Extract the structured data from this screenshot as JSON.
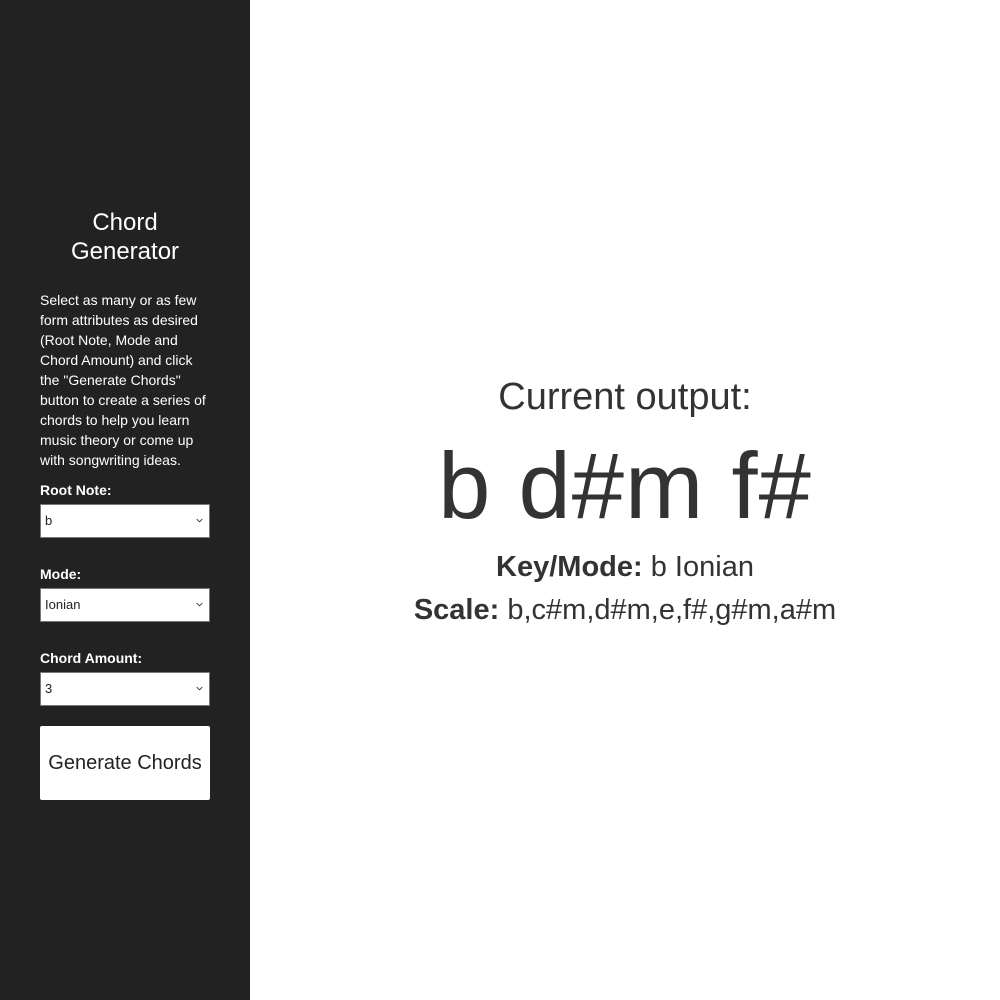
{
  "sidebar": {
    "title": "Chord\nGenerator",
    "description": "Select as many or as few form attributes as desired (Root Note, Mode and Chord Amount) and click the \"Generate Chords\" button to create a series of chords to help you learn music theory or come up with songwriting ideas.",
    "root_note": {
      "label": "Root Note:",
      "value": "b"
    },
    "mode": {
      "label": "Mode:",
      "value": "Ionian"
    },
    "chord_amount": {
      "label": "Chord Amount:",
      "value": "3"
    },
    "generate_label": "Generate Chords"
  },
  "output": {
    "heading": "Current output:",
    "chords": "b d#m f#",
    "key_mode_label": "Key/Mode:",
    "key_mode_value": "b Ionian",
    "scale_label": "Scale:",
    "scale_value": "b,c#m,d#m,e,f#,g#m,a#m"
  },
  "colors": {
    "sidebar_bg": "#222222",
    "sidebar_text": "#ffffff",
    "main_bg": "#ffffff",
    "main_text": "#333333"
  },
  "icons": {
    "select_arrow": "chevron-down-icon"
  }
}
